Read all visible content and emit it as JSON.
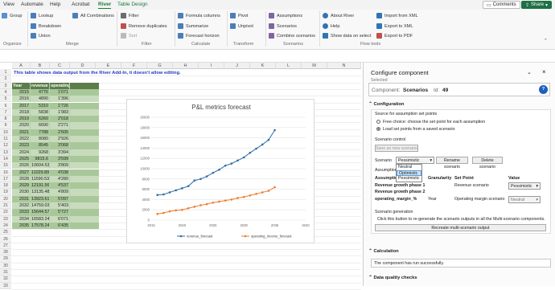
{
  "tabs": [
    "View",
    "Automate",
    "Help",
    "Acrobat",
    "River",
    "Table Design"
  ],
  "top_buttons": {
    "comments": "Comments",
    "share": "Share"
  },
  "ribbon": {
    "organize": {
      "group_btn": "Group",
      "label": "Organize"
    },
    "merge": {
      "items": [
        "Lookup",
        "Breakdown",
        "Union",
        "All Combinations"
      ],
      "label": "Merge"
    },
    "filter": {
      "items": [
        "Filter",
        "Remove duplicates",
        "Sort"
      ],
      "label": "Filter"
    },
    "calculate": {
      "items": [
        "Formula columns",
        "Summarize",
        "Forecast horizon"
      ],
      "label": "Calculate"
    },
    "transform": {
      "items": [
        "Pivot",
        "Unpivot"
      ],
      "label": "Transform"
    },
    "scenarios": {
      "items": [
        "Assumptions",
        "Scenarios",
        "Combine scenarios"
      ],
      "label": "Scenarios"
    },
    "flow": {
      "items": [
        "About River",
        "Help",
        "Show data on select",
        "Import from XML",
        "Export to XML",
        "Export to PDF"
      ],
      "label": "Flow tools"
    }
  },
  "grid": {
    "columns": [
      "A",
      "B",
      "C",
      "D",
      "E",
      "F",
      "G",
      "H",
      "I",
      "J",
      "K",
      "L",
      "M",
      "N"
    ],
    "notice": "This table shows data output from the River Add-In, it doesn't allow editing.",
    "headers": [
      "Year",
      "revenue",
      "operating"
    ],
    "rows": [
      [
        "2015",
        "4776",
        "1'071"
      ],
      [
        "2016",
        "4890",
        "1'396"
      ],
      [
        "2017",
        "5310",
        "1'726"
      ],
      [
        "2018",
        "5838",
        "1'983"
      ],
      [
        "2019",
        "6260",
        "2'018"
      ],
      [
        "2020",
        "6690",
        "2'271"
      ],
      [
        "2021",
        "7788",
        "2'605"
      ],
      [
        "2022",
        "8080",
        "2'926"
      ],
      [
        "2023",
        "8545",
        "3'068"
      ],
      [
        "2024",
        "9268",
        "3'394"
      ],
      [
        "2025",
        "9815.6",
        "3'599"
      ],
      [
        "2026",
        "10604.536",
        "3'809"
      ],
      [
        "2027",
        "11029.8982",
        "4'038"
      ],
      [
        "2028",
        "11590.5386",
        "4'280"
      ],
      [
        "2029",
        "12191.5688",
        "4'537"
      ],
      [
        "2030",
        "13135.487",
        "4'809"
      ],
      [
        "2031",
        "13923.6162",
        "5'097"
      ],
      [
        "2032",
        "14759.0332",
        "5'403"
      ],
      [
        "2033",
        "15644.5752",
        "5'727"
      ],
      [
        "2034",
        "16583.2497",
        "6'071"
      ],
      [
        "2035",
        "17578.2447",
        "6'435"
      ]
    ],
    "row_numbers": [
      "1",
      "2",
      "3",
      "4",
      "5",
      "6",
      "7",
      "8",
      "9",
      "10",
      "11",
      "12",
      "13",
      "14",
      "15",
      "16",
      "17",
      "18",
      "19",
      "20",
      "21",
      "22",
      "23",
      "24",
      "25",
      "26",
      "27",
      "28",
      "29",
      "30",
      "31",
      "32",
      "33"
    ]
  },
  "chart_data": {
    "type": "line",
    "title": "P&L metrics forecast",
    "x": [
      2016,
      2017,
      2018,
      2019,
      2020,
      2021,
      2022,
      2023,
      2024,
      2025,
      2026,
      2027,
      2028,
      2029,
      2030,
      2031,
      2032,
      2033,
      2034,
      2035
    ],
    "series": [
      {
        "name": "revenue_forecast",
        "color": "#2e6da4",
        "values": [
          4890,
          5000,
          5400,
          5800,
          6200,
          6600,
          7700,
          8000,
          8500,
          9200,
          9800,
          10600,
          11000,
          11600,
          12200,
          13100,
          13900,
          14700,
          15600,
          17500
        ]
      },
      {
        "name": "operating_income_forecast",
        "color": "#ed7d31",
        "values": [
          1200,
          1400,
          1700,
          1900,
          2000,
          2300,
          2600,
          2900,
          3100,
          3400,
          3600,
          3800,
          4000,
          4300,
          4500,
          4800,
          5100,
          5400,
          5700,
          6400
        ]
      }
    ],
    "xlim": [
      2015,
      2040
    ],
    "ylim": [
      0,
      20000
    ],
    "xticks": [
      "2015",
      "2020",
      "2025",
      "2030",
      "2035",
      "2040"
    ],
    "yticks": [
      "0",
      "2000",
      "4000",
      "6000",
      "8000",
      "10000",
      "12000",
      "14000",
      "16000",
      "18000",
      "20000"
    ],
    "legend_position": "bottom"
  },
  "panel": {
    "title": "Configure component",
    "selected_label": "Selected",
    "component_label": "Component:",
    "component_value": "Scenarios",
    "id_label": "Id:",
    "id_value": "49",
    "config_section": "Configuration",
    "source_label": "Source for assumption set points",
    "radio1": "Free choice: choose the set point for each assumption",
    "radio2": "Load set points from a saved scenario",
    "scenario_control": "Scenario control",
    "save_new": "Save as new scenario",
    "scenario_label": "Scenario",
    "scenario_value": "Pessimistic",
    "rename_btn": "Rename scenario",
    "delete_btn": "Delete scenario",
    "dropdown_options": [
      "Neutral",
      "Optimistic",
      "Pessimistic"
    ],
    "assumptions_label": "Assumptions",
    "table_headers": [
      "Assumption",
      "Granularity",
      "Set Point",
      "Value"
    ],
    "assumption_rows": [
      [
        "Revenue growth phase 1",
        "",
        "Revenue scenario",
        "Pessimistic"
      ],
      [
        "Revenue growth phase 2",
        "",
        "",
        ""
      ],
      [
        "operating_margin_%",
        "Year",
        "Operating margin scenario",
        "Neutral"
      ]
    ],
    "scenario_gen_label": "Scenario generation",
    "scenario_gen_text": "Click this button to re-generate the scenario outputs in all the Multi-scenario components.",
    "regenerate_btn": "Recreate multi-scenario output",
    "calculation_section": "Calculation",
    "calc_message": "The component has run successfully.",
    "data_quality_section": "Data quality checks"
  }
}
